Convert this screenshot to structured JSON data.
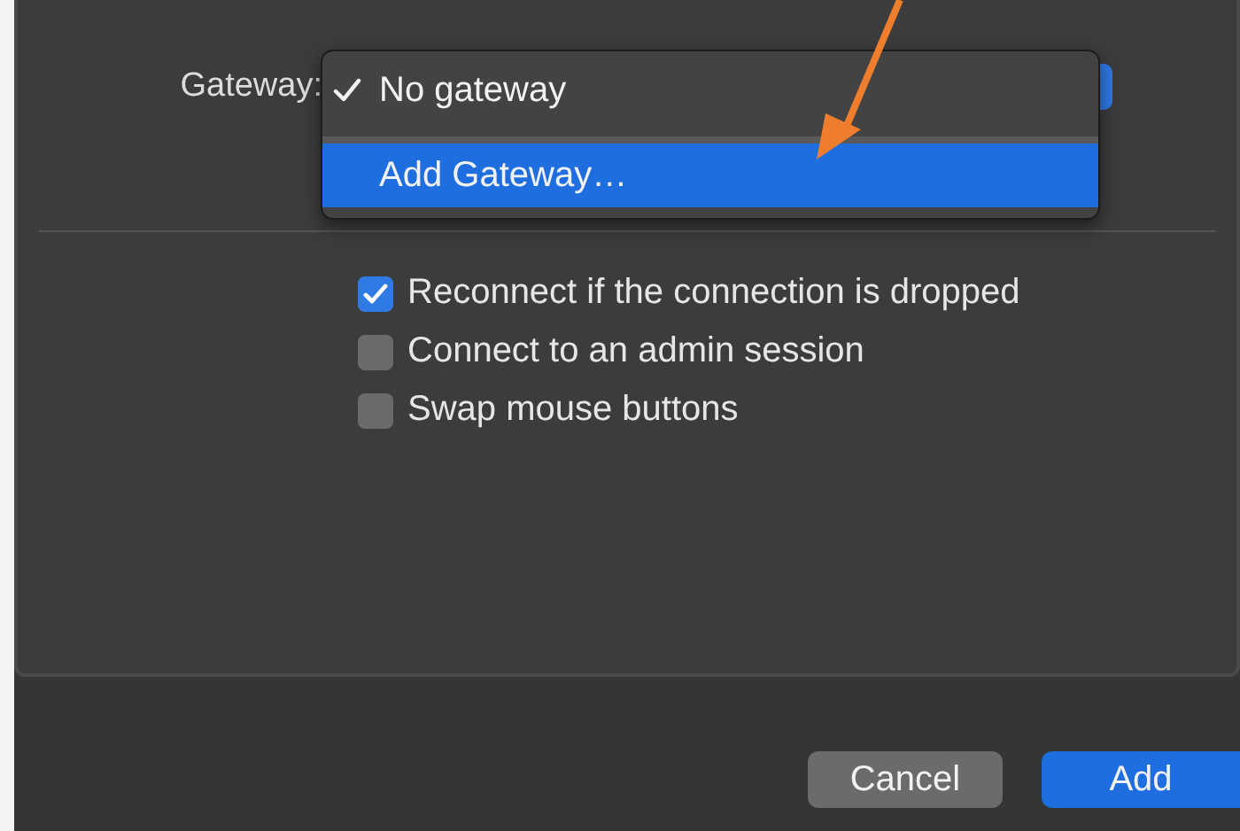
{
  "gateway": {
    "label": "Gateway:",
    "menu": [
      {
        "label": "No gateway",
        "checked": true,
        "selected": false
      },
      {
        "label": "Add Gateway…",
        "checked": false,
        "selected": true
      }
    ]
  },
  "options": [
    {
      "label": "Reconnect if the connection is dropped",
      "checked": true
    },
    {
      "label": "Connect to an admin session",
      "checked": false
    },
    {
      "label": "Swap mouse buttons",
      "checked": false
    }
  ],
  "buttons": [
    {
      "label": "Cancel",
      "kind": "secondary"
    },
    {
      "label": "Add",
      "kind": "default"
    }
  ]
}
